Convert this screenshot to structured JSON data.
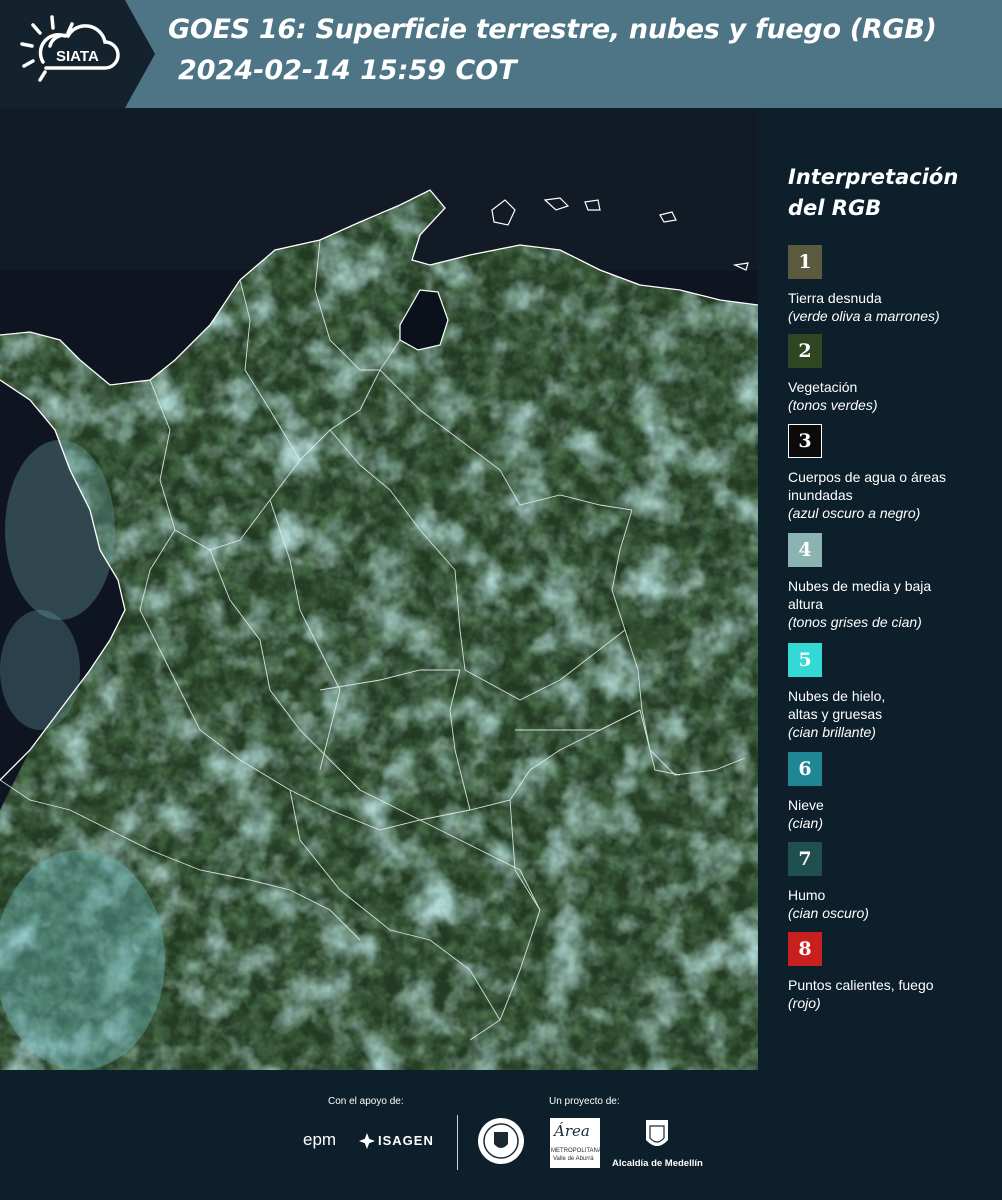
{
  "header": {
    "logo_text": "SIATA",
    "title": "GOES 16: Superficie terrestre, nubes y fuego (RGB)",
    "datetime": "2024-02-14 15:59 COT"
  },
  "legend": {
    "title_line1": "Interpretación",
    "title_line2": "del RGB",
    "items": [
      {
        "num": "1",
        "color": "#5c5a3e",
        "label": "Tierra desnuda",
        "sub": "(verde oliva a marrones)"
      },
      {
        "num": "2",
        "color": "#2f4622",
        "label": "Vegetación",
        "sub": "(tonos verdes)"
      },
      {
        "num": "3",
        "color": "#0b0b0b",
        "label": "Cuerpos de agua o áreas inundadas",
        "sub": "(azul oscuro a negro)"
      },
      {
        "num": "4",
        "color": "#8bb3b1",
        "label": "Nubes de media y baja altura",
        "sub": "(tonos grises de cian)"
      },
      {
        "num": "5",
        "color": "#33d9d5",
        "label": "Nubes de hielo, altas y gruesas",
        "sub": "(cian brillante)"
      },
      {
        "num": "6",
        "color": "#1f8696",
        "label": "Nieve",
        "sub": "(cian)"
      },
      {
        "num": "7",
        "color": "#1f4f4f",
        "label": "Humo",
        "sub": "(cian oscuro)"
      },
      {
        "num": "8",
        "color": "#c8201f",
        "label": "Puntos calientes, fuego",
        "sub": "(rojo)"
      }
    ]
  },
  "footer": {
    "support_caption": "Con el apoyo de:",
    "project_caption": "Un proyecto de:",
    "epm": "epm",
    "isagen": "ISAGEN",
    "area_line1": "Área",
    "area_line2": "METROPOLITANA",
    "area_line3": "Valle de Aburrá",
    "alcaldia": "Alcaldía de Medellín"
  }
}
